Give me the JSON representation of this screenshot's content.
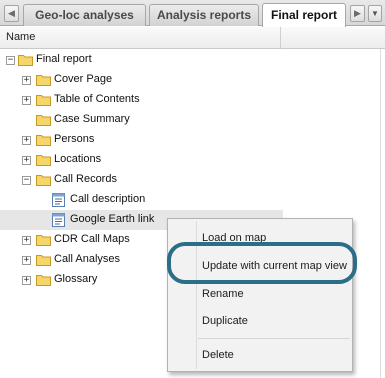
{
  "tabs": {
    "items": [
      {
        "label": "Geo-loc analyses"
      },
      {
        "label": "Analysis reports"
      },
      {
        "label": "Final report",
        "active": true
      }
    ],
    "scroll_left_icon": "arrow-left-icon",
    "scroll_right_icon": "arrow-right-icon",
    "menu_icon": "chevron-down-icon",
    "scroll_left_glyph": "◀",
    "scroll_right_glyph": "▶",
    "menu_glyph": "▼"
  },
  "column_header": {
    "name": "Name"
  },
  "tree": {
    "root": {
      "label": "Final report",
      "expanded": true
    },
    "items": [
      {
        "label": "Cover Page",
        "type": "folder",
        "expander": "+"
      },
      {
        "label": "Table of Contents",
        "type": "folder",
        "expander": "+"
      },
      {
        "label": "Case Summary",
        "type": "folder",
        "expander": ""
      },
      {
        "label": "Persons",
        "type": "folder",
        "expander": "+"
      },
      {
        "label": "Locations",
        "type": "folder",
        "expander": "+"
      },
      {
        "label": "Call Records",
        "type": "folder",
        "expander": "−",
        "expanded": true,
        "children": [
          {
            "label": "Call description",
            "type": "document"
          },
          {
            "label": "Google Earth link",
            "type": "document",
            "selected": true
          }
        ]
      },
      {
        "label": "CDR Call Maps",
        "type": "folder",
        "expander": "+"
      },
      {
        "label": "Call Analyses",
        "type": "folder",
        "expander": "+"
      },
      {
        "label": "Glossary",
        "type": "folder",
        "expander": "+"
      }
    ]
  },
  "context_menu": {
    "items": [
      {
        "label": "Load on map"
      },
      {
        "label": "Update with current map view",
        "highlighted": true
      },
      {
        "label": "Rename"
      },
      {
        "label": "Duplicate"
      },
      {
        "label": "Delete"
      }
    ]
  },
  "colors": {
    "highlight_ring": "#2b6e87",
    "folder": "#f2c94c",
    "selection": "#e6e6e6"
  }
}
